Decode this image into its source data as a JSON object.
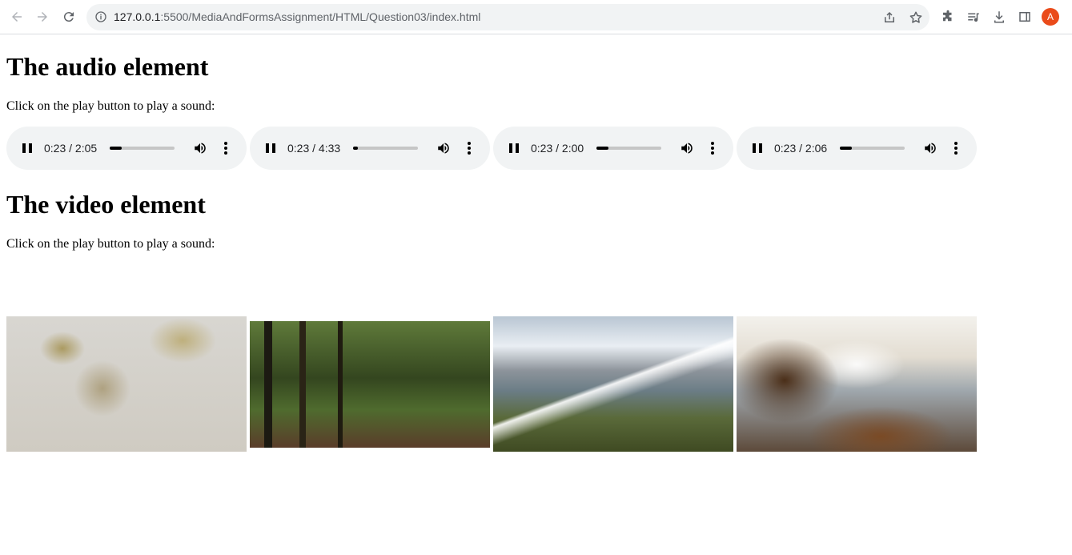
{
  "browser": {
    "url_host": "127.0.0.1",
    "url_rest": ":5500/MediaAndFormsAssignment/HTML/Question03/index.html",
    "avatar_letter": "A"
  },
  "audio_section": {
    "heading": "The audio element",
    "instruction": "Click on the play button to play a sound:",
    "players": [
      {
        "time": "0:23 / 2:05",
        "progress": 0.18
      },
      {
        "time": "0:23 / 4:33",
        "progress": 0.08
      },
      {
        "time": "0:23 / 2:00",
        "progress": 0.19
      },
      {
        "time": "0:23 / 2:06",
        "progress": 0.18
      }
    ]
  },
  "video_section": {
    "heading": "The video element",
    "instruction": "Click on the play button to play a sound:",
    "videos": [
      {
        "subject": "tree branches with yellow leaves"
      },
      {
        "subject": "forest with tall trees"
      },
      {
        "subject": "snowy mountain valley with river"
      },
      {
        "subject": "rocky coast with crashing waves"
      }
    ]
  }
}
